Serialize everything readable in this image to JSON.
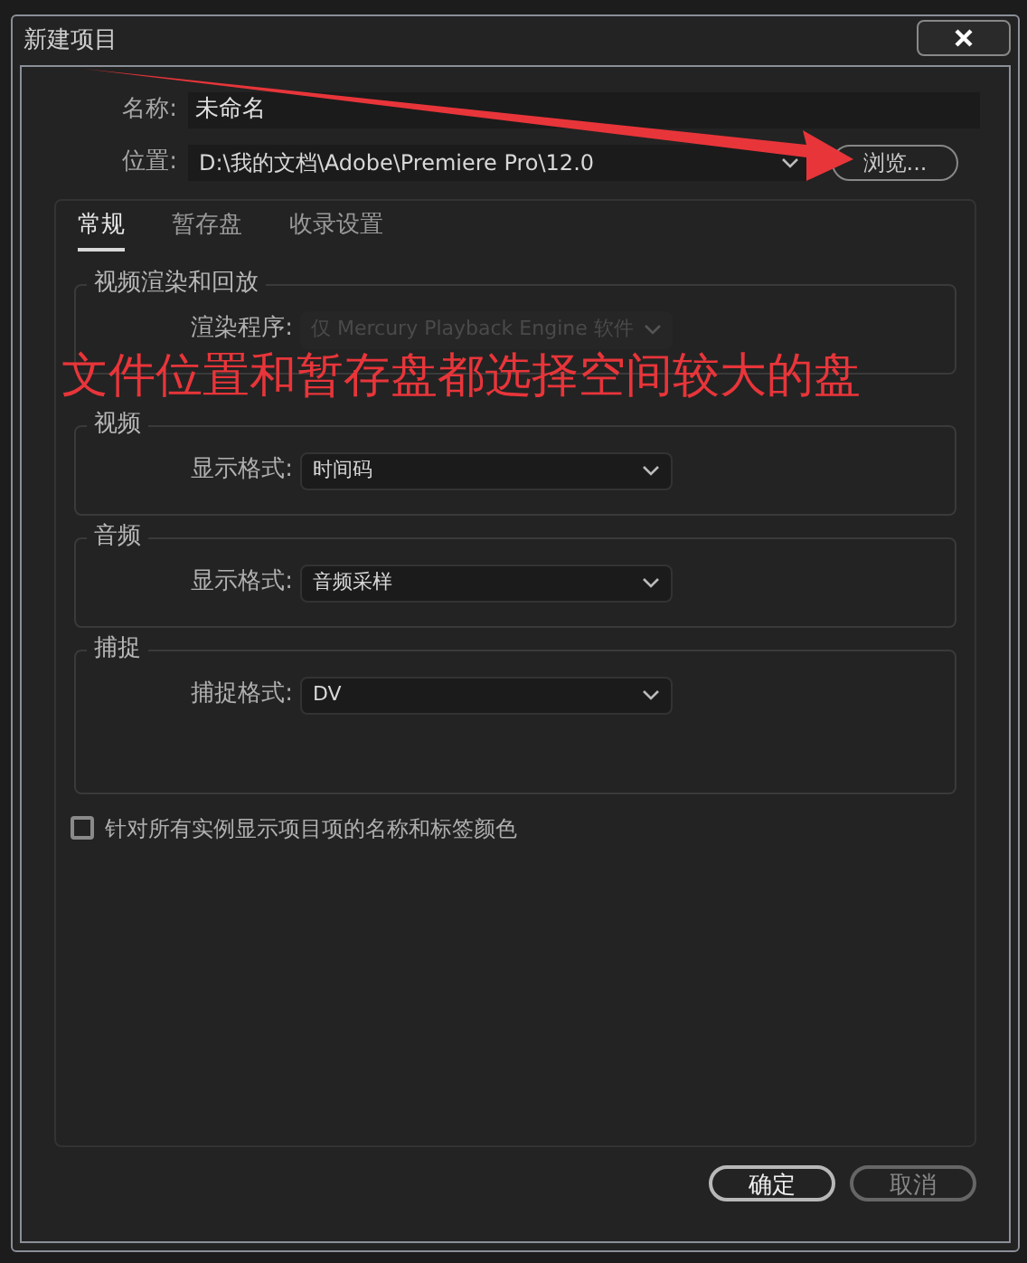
{
  "window": {
    "title": "新建项目"
  },
  "name_field": {
    "label": "名称:",
    "value": "未命名"
  },
  "location_field": {
    "label": "位置:",
    "value": "D:\\我的文档\\Adobe\\Premiere Pro\\12.0",
    "button": "浏览..."
  },
  "tabs": [
    {
      "label": "常规",
      "selected": true
    },
    {
      "label": "暂存盘",
      "selected": false
    },
    {
      "label": "收录设置",
      "selected": false
    }
  ],
  "groups": [
    {
      "title": "视频渲染和回放",
      "label": "渲染程序:",
      "value": "仅 Mercury Playback Engine 软件",
      "disabled": true,
      "tall": false
    },
    {
      "title": "视频",
      "label": "显示格式:",
      "value": "时间码",
      "disabled": false,
      "tall": false
    },
    {
      "title": "音频",
      "label": "显示格式:",
      "value": "音频采样",
      "disabled": false,
      "tall": false
    },
    {
      "title": "捕捉",
      "label": "捕捉格式:",
      "value": "DV",
      "disabled": false,
      "tall": true
    }
  ],
  "checkbox": {
    "label": "针对所有实例显示项目项的名称和标签颜色",
    "checked": false
  },
  "buttons": [
    {
      "label": "确定",
      "primary": true
    },
    {
      "label": "取消",
      "primary": false
    }
  ],
  "annotation": {
    "text": "文件位置和暂存盘都选择空间较大的盘"
  }
}
